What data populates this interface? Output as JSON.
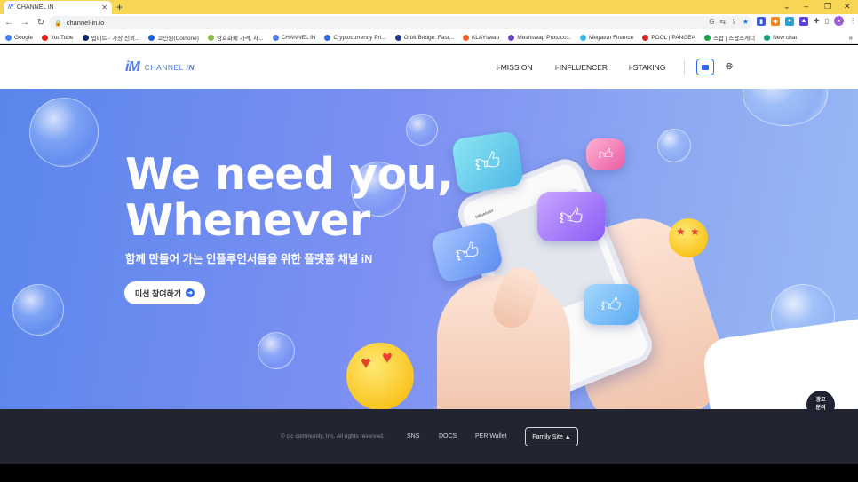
{
  "browser": {
    "tab_title": "CHANNEL iN",
    "tab_favicon": "///",
    "url": "channel-in.io",
    "bookmarks": [
      {
        "label": "Google",
        "color": "#4285f4"
      },
      {
        "label": "YouTube",
        "color": "#e62117"
      },
      {
        "label": "업비트 - 가장 신뢰...",
        "color": "#0a2a6b"
      },
      {
        "label": "코인원(Coinone)",
        "color": "#1b5fd6"
      },
      {
        "label": "암호화폐 가격, 차...",
        "color": "#8bc34a"
      },
      {
        "label": "CHANNEL iN",
        "color": "#4f7ee8"
      },
      {
        "label": "Cryptocurrency Pri...",
        "color": "#2f6ae8"
      },
      {
        "label": "Orbit Bridge: Fast...",
        "color": "#1e3a8a"
      },
      {
        "label": "KLAYswap",
        "color": "#f26322"
      },
      {
        "label": "Meshswap Protoco...",
        "color": "#6b46c1"
      },
      {
        "label": "Megaton Finance",
        "color": "#38bdf8"
      },
      {
        "label": "POOL | PANGEA",
        "color": "#dc2626"
      },
      {
        "label": "스왑 | 스왑스캐너",
        "color": "#16a34a"
      },
      {
        "label": "New chat",
        "color": "#10a37f"
      }
    ]
  },
  "header": {
    "logo_mark": "iM",
    "logo_text": "CHANNEL",
    "logo_text_bold": "iN",
    "nav": [
      "i-MISSION",
      "i-INFLUENCER",
      "i-STAKING"
    ]
  },
  "hero": {
    "headline_1": "We need you,",
    "headline_2": "Whenever",
    "subtitle": "함께 만들어 가는 인플루언서들을 위한 플랫폼 채널 iN",
    "cta_label": "미션 참여하기",
    "phone_username": "influencer"
  },
  "ad_badge": {
    "line1": "광고",
    "line2": "문의"
  },
  "footer": {
    "copyright": "© cic community, Inc. All rights reserved.",
    "links": [
      "SNS",
      "DOCS",
      "PER Wallet"
    ],
    "family_site": "Family Site ▲"
  }
}
